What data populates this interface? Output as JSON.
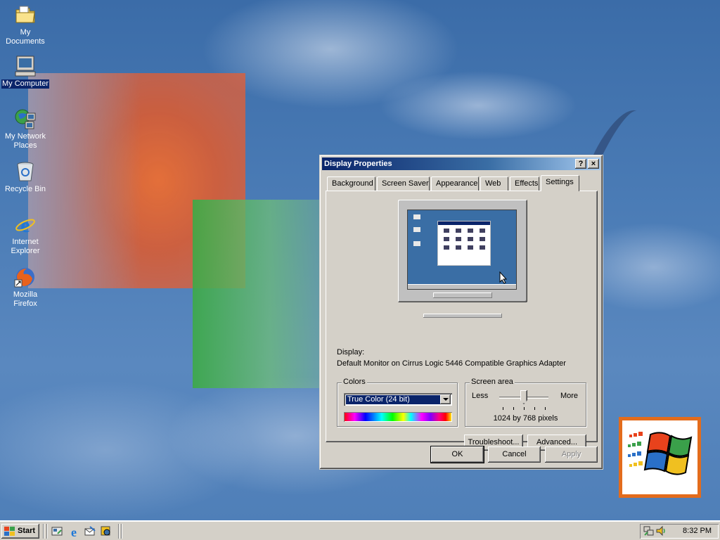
{
  "desktop": {
    "icons": [
      {
        "label": "My Documents",
        "icon": "folder-icon"
      },
      {
        "label": "My Computer",
        "icon": "computer-icon"
      },
      {
        "label": "My Network Places",
        "icon": "network-icon"
      },
      {
        "label": "Recycle Bin",
        "icon": "recycle-bin-icon"
      },
      {
        "label": "Internet Explorer",
        "icon": "internet-explorer-icon"
      },
      {
        "label": "Mozilla Firefox",
        "icon": "firefox-icon"
      }
    ]
  },
  "dialog": {
    "title": "Display Properties",
    "help_button": "?",
    "close_button": "×",
    "tabs": [
      {
        "label": "Background"
      },
      {
        "label": "Screen Saver"
      },
      {
        "label": "Appearance"
      },
      {
        "label": "Web"
      },
      {
        "label": "Effects"
      },
      {
        "label": "Settings",
        "active": true
      }
    ],
    "display_label": "Display:",
    "display_value": "Default Monitor on Cirrus Logic 5446 Compatible Graphics Adapter",
    "colors": {
      "group_title": "Colors",
      "selected": "True Color (24 bit)"
    },
    "screen_area": {
      "group_title": "Screen area",
      "less": "Less",
      "more": "More",
      "resolution": "1024 by 768 pixels"
    },
    "buttons": {
      "troubleshoot": "Troubleshoot...",
      "advanced": "Advanced...",
      "ok": "OK",
      "cancel": "Cancel",
      "apply": "Apply"
    }
  },
  "taskbar": {
    "start_label": "Start",
    "quick_launch": [
      "show-desktop-icon",
      "internet-explorer-icon",
      "outlook-express-icon",
      "windows-media-icon"
    ],
    "clock": "8:32 PM"
  },
  "colors": {
    "title_bar": "#0a246a",
    "desktop": "#3a6ea5",
    "face": "#d4d0c8"
  }
}
